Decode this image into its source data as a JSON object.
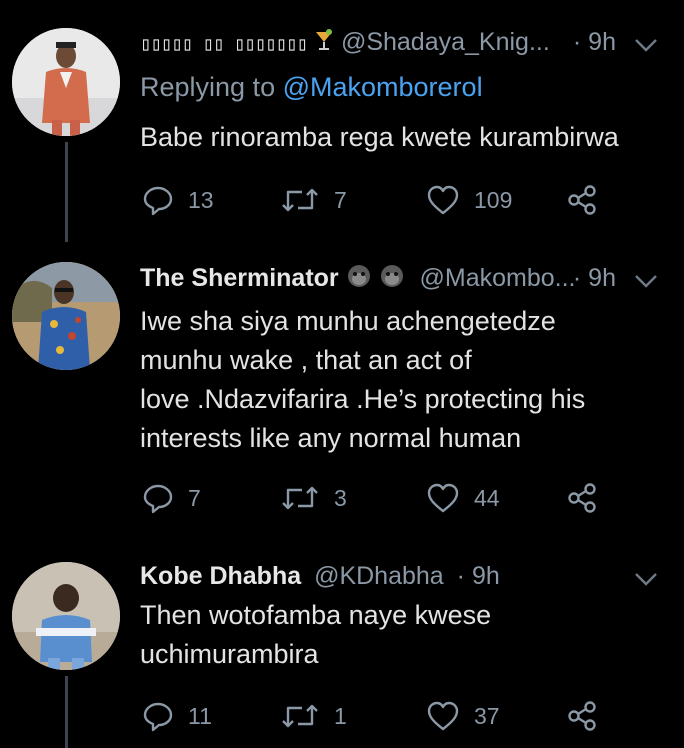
{
  "tweets": [
    {
      "name": "▯▯▯▯▯ ▯▯ ▯▯▯▯▯▯▯",
      "handle": "@Shadaya_Knig...",
      "time": "· 9h",
      "replying_prefix": "Replying to ",
      "replying_mention": "@Makomborerol",
      "text": "Babe rinoramba rega kwete kurambirwa",
      "replies": "13",
      "retweets": "7",
      "likes": "109"
    },
    {
      "name": "The Sherminator",
      "handle": "@Makombo...",
      "time": "· 9h",
      "text_lines": [
        "Iwe sha siya munhu achengetedze",
        "munhu wake , that an act of",
        "love .Ndazvifarira .He’s protecting his",
        "interests like any normal human"
      ],
      "replies": "7",
      "retweets": "3",
      "likes": "44"
    },
    {
      "name": "Kobe Dhabha",
      "handle": "@KDhabha",
      "time": "· 9h",
      "text_lines": [
        "Then wotofamba naye kwese",
        "uchimurambira"
      ],
      "replies": "11",
      "retweets": "1",
      "likes": "37"
    }
  ],
  "icons": {
    "reply": "reply-icon",
    "retweet": "retweet-icon",
    "like": "heart-icon",
    "share": "share-icon",
    "more": "chevron-down-icon"
  },
  "colors": {
    "background": "#000000",
    "mention": "#4aa3f0",
    "secondary": "#8b98a5"
  }
}
